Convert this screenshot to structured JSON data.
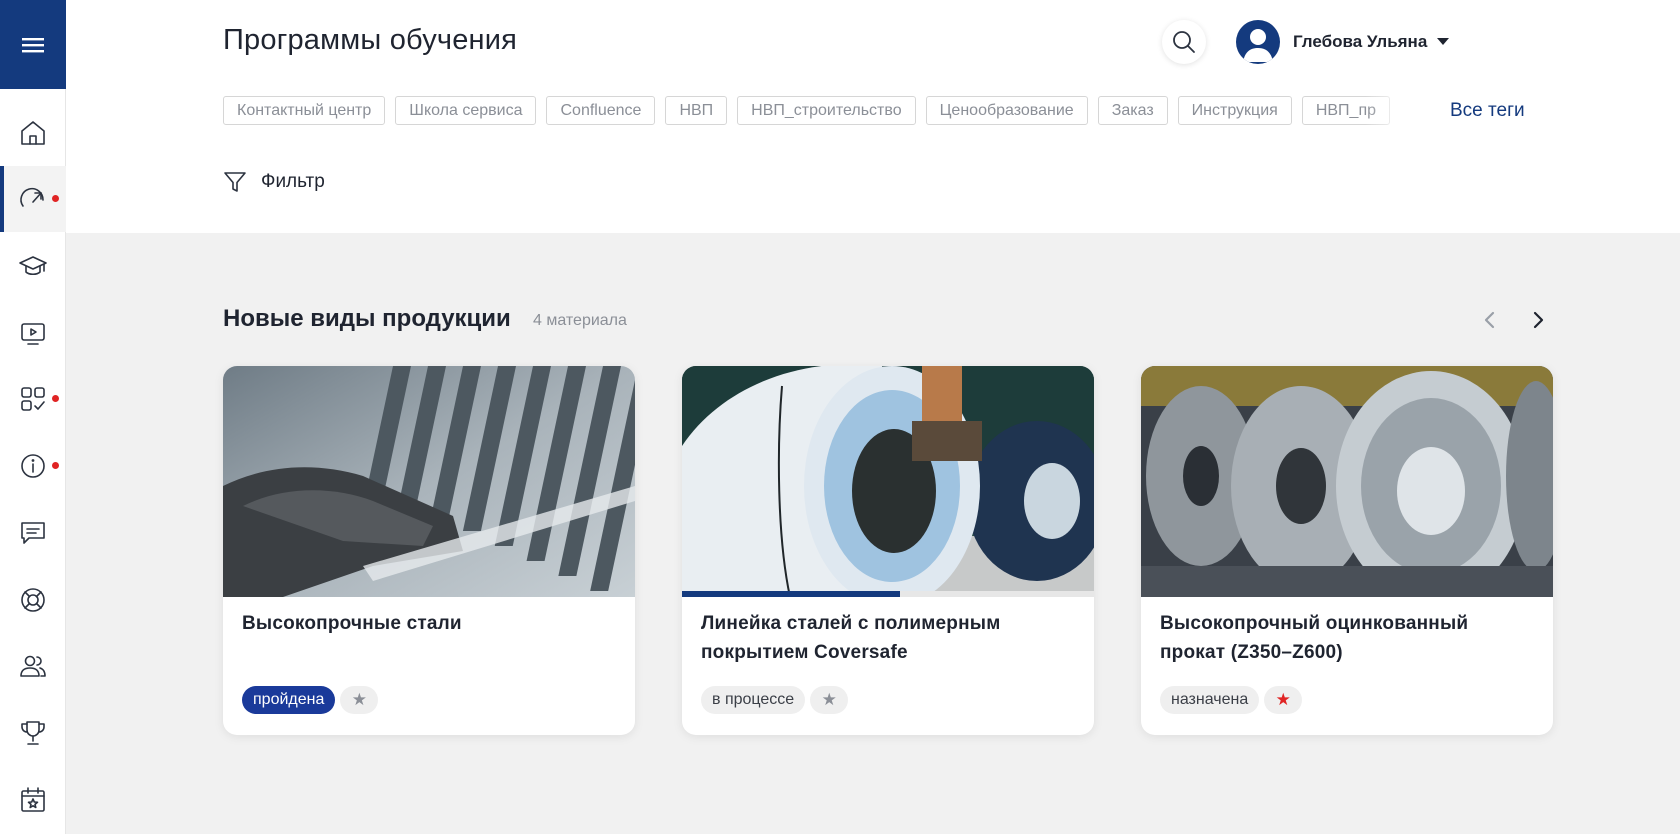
{
  "header": {
    "title": "Программы обучения",
    "user_name": "Глебова Ульяна",
    "all_tags_label": "Все теги",
    "filter_label": "Фильтр",
    "tags": [
      "Контактный центр",
      "Школа сервиса",
      "Confluence",
      "НВП",
      "НВП_строительство",
      "Ценообразование",
      "Заказ",
      "Инструкция",
      "НВП_пр"
    ]
  },
  "sidebar": {
    "items": [
      {
        "icon": "home-icon",
        "active": false,
        "dot": false
      },
      {
        "icon": "dashboard-gauge-icon",
        "active": true,
        "dot": true
      },
      {
        "icon": "graduation-cap-icon",
        "active": false,
        "dot": false
      },
      {
        "icon": "video-player-icon",
        "active": false,
        "dot": false
      },
      {
        "icon": "tasks-grid-icon",
        "active": false,
        "dot": true
      },
      {
        "icon": "info-icon",
        "active": false,
        "dot": true
      },
      {
        "icon": "chat-icon",
        "active": false,
        "dot": false
      },
      {
        "icon": "support-lifebuoy-icon",
        "active": false,
        "dot": false
      },
      {
        "icon": "users-icon",
        "active": false,
        "dot": false
      },
      {
        "icon": "trophy-icon",
        "active": false,
        "dot": false
      },
      {
        "icon": "calendar-star-icon",
        "active": false,
        "dot": false
      }
    ]
  },
  "section": {
    "title": "Новые виды продукции",
    "count": "4 материала"
  },
  "cards": [
    {
      "title": "Высокопрочные стали",
      "status": "пройдена",
      "status_type": "done",
      "favorite": false,
      "star_color": "#8b8f97",
      "progress": null
    },
    {
      "title": "Линейка сталей с полимерным покрытием Coversafe",
      "status": "в процессе",
      "status_type": "other",
      "favorite": false,
      "star_color": "#8b8f97",
      "progress": 0.53
    },
    {
      "title": "Высокопрочный оцинкованный прокат (Z350–Z600)",
      "status": "назначена",
      "status_type": "other",
      "favorite": true,
      "star_color": "#e02424",
      "progress": null
    }
  ],
  "colors": {
    "brand": "#143a7e",
    "status_done": "#1a3a9a",
    "notification_dot": "#e02424",
    "arrow_disabled": "#9aa0a8",
    "arrow_enabled": "#1f2430"
  }
}
